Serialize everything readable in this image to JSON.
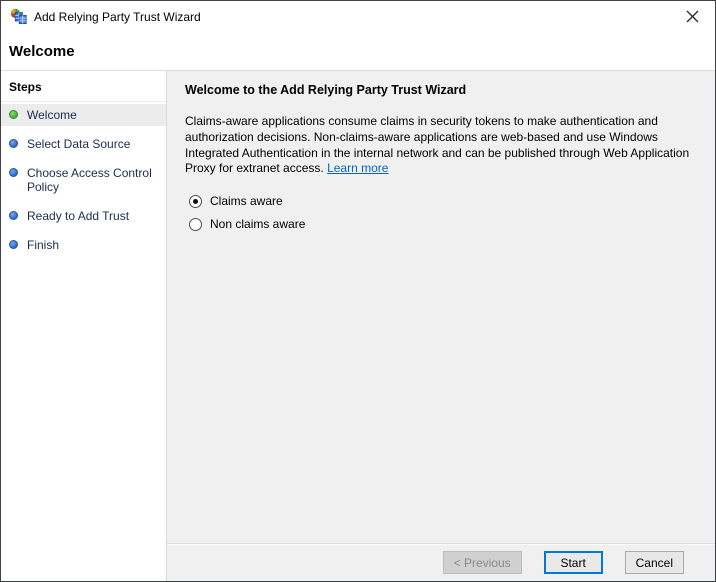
{
  "window": {
    "title": "Add Relying Party Trust Wizard"
  },
  "header": {
    "title": "Welcome"
  },
  "sidebar": {
    "heading": "Steps",
    "items": [
      {
        "label": "Welcome",
        "state": "active"
      },
      {
        "label": "Select Data Source",
        "state": "pending"
      },
      {
        "label": "Choose Access Control Policy",
        "state": "pending"
      },
      {
        "label": "Ready to Add Trust",
        "state": "pending"
      },
      {
        "label": "Finish",
        "state": "pending"
      }
    ]
  },
  "main": {
    "heading": "Welcome to the Add Relying Party Trust Wizard",
    "description": "Claims-aware applications consume claims in security tokens to make authentication and authorization decisions. Non-claims-aware applications are web-based and use Windows Integrated Authentication in the internal network and can be published through Web Application Proxy for extranet access.",
    "link_label": "Learn more",
    "radios": [
      {
        "label": "Claims aware",
        "selected": true
      },
      {
        "label": "Non claims aware",
        "selected": false
      }
    ]
  },
  "footer": {
    "previous_label": "< Previous",
    "previous_disabled": true,
    "start_label": "Start",
    "cancel_label": "Cancel"
  },
  "icons": {
    "app": "adfs-wizard-icon",
    "close": "close-icon",
    "step_active": "green-dot-icon",
    "step_pending": "blue-dot-icon"
  },
  "colors": {
    "content_background": "#f0f0f0",
    "sidebar_background": "#ffffff",
    "active_step_background": "#ececec",
    "step_text": "#1c2b50",
    "link": "#0563c1",
    "focus_accent": "#0078d7",
    "active_bullet_green": "#45b035",
    "pending_bullet_blue": "#2f6bcd"
  }
}
